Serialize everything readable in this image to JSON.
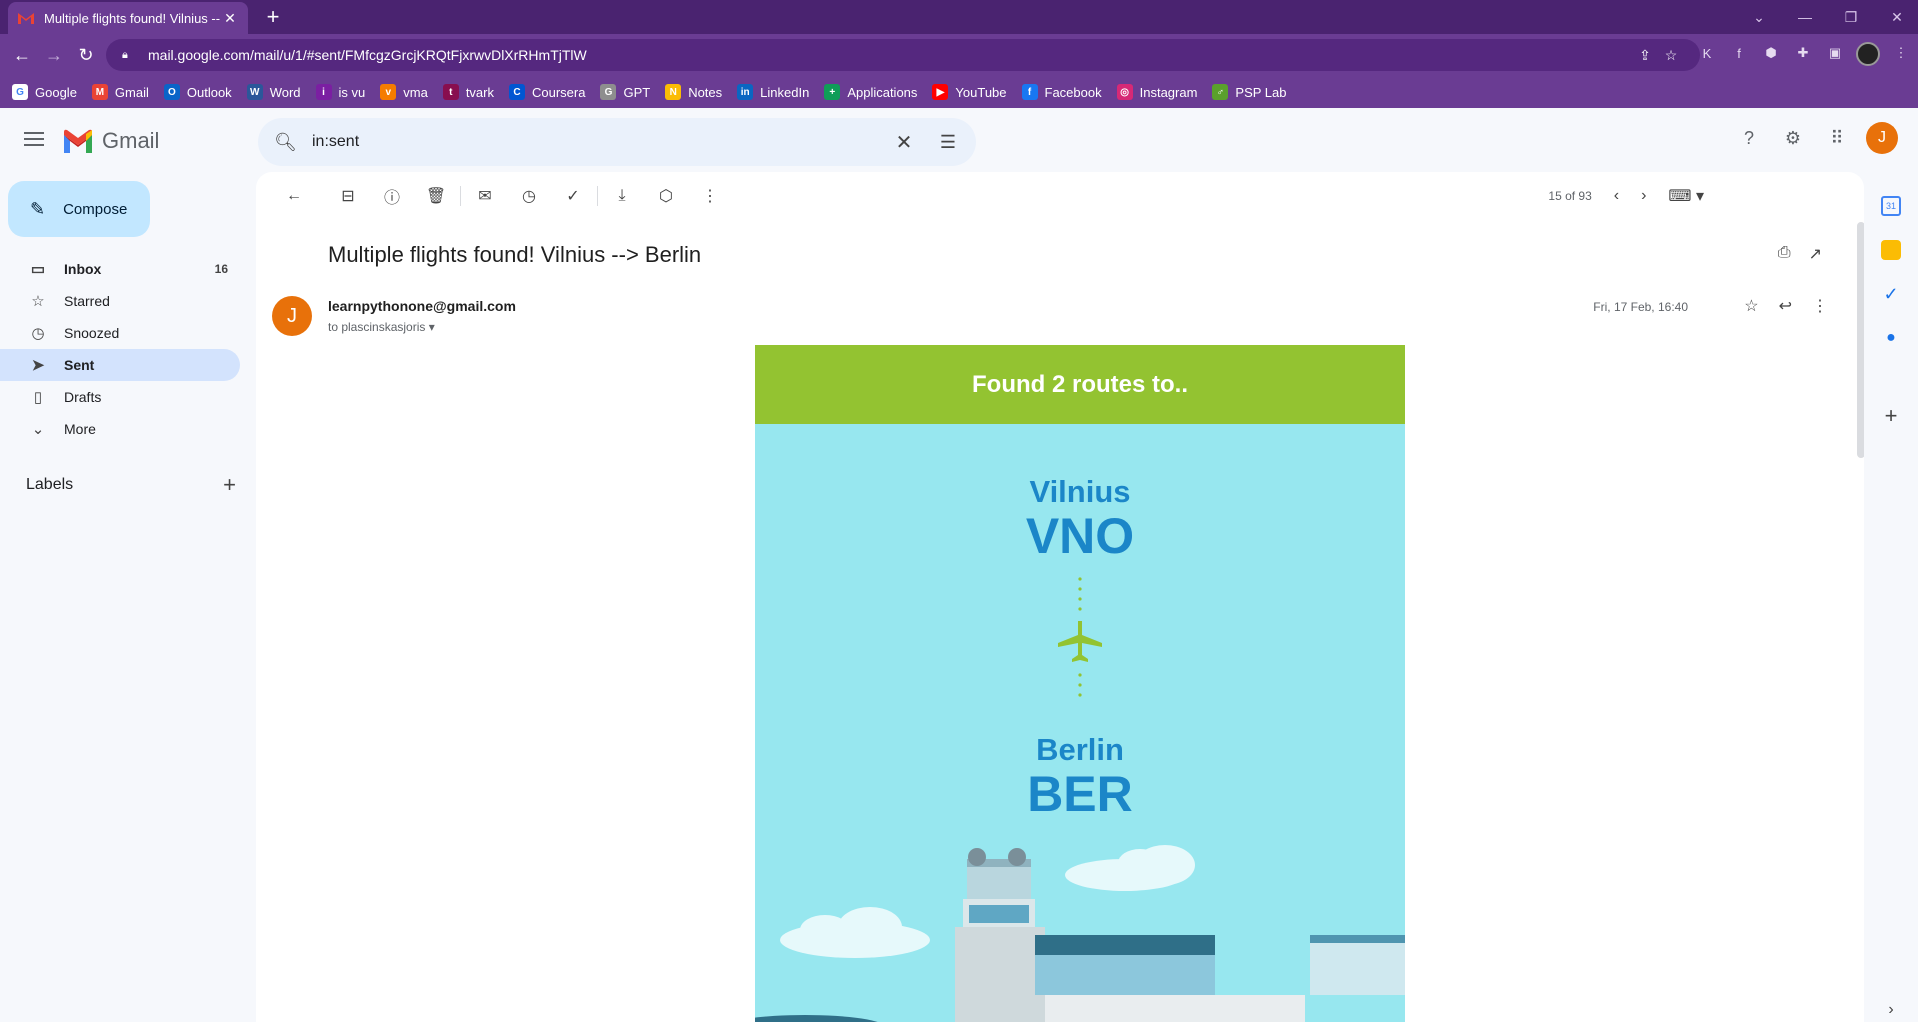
{
  "browser": {
    "tab_title": "Multiple flights found! Vilnius --",
    "url": "mail.google.com/mail/u/1/#sent/FMfcgzGrcjKRQtFjxrwvDlXrRHmTjTlW",
    "bookmarks": [
      {
        "label": "Google",
        "color": "#ffffff",
        "glyph": "G"
      },
      {
        "label": "Gmail",
        "color": "#ea4335",
        "glyph": "M"
      },
      {
        "label": "Outlook",
        "color": "#0a64c8",
        "glyph": "O"
      },
      {
        "label": "Word",
        "color": "#2b579a",
        "glyph": "W"
      },
      {
        "label": "is vu",
        "color": "#7b1fa2",
        "glyph": "i"
      },
      {
        "label": "vma",
        "color": "#f57c00",
        "glyph": "v"
      },
      {
        "label": "tvark",
        "color": "#880e4f",
        "glyph": "t"
      },
      {
        "label": "Coursera",
        "color": "#0056d2",
        "glyph": "C"
      },
      {
        "label": "GPT",
        "color": "#8e8e8e",
        "glyph": "G"
      },
      {
        "label": "Notes",
        "color": "#fbbc04",
        "glyph": "N"
      },
      {
        "label": "LinkedIn",
        "color": "#0a66c2",
        "glyph": "in"
      },
      {
        "label": "Applications",
        "color": "#0f9d58",
        "glyph": "+"
      },
      {
        "label": "YouTube",
        "color": "#ff0000",
        "glyph": "▶"
      },
      {
        "label": "Facebook",
        "color": "#1877f2",
        "glyph": "f"
      },
      {
        "label": "Instagram",
        "color": "#d62976",
        "glyph": "◎"
      },
      {
        "label": "PSP Lab",
        "color": "#5aa02c",
        "glyph": "♂"
      }
    ]
  },
  "gmail": {
    "brand": "Gmail",
    "search_query": "in:sent",
    "compose_label": "Compose",
    "avatar_letter": "J",
    "nav": [
      {
        "label": "Inbox",
        "count": "16",
        "icon": "inbox-icon",
        "glyph": "▭"
      },
      {
        "label": "Starred",
        "count": "",
        "icon": "star-icon",
        "glyph": "☆"
      },
      {
        "label": "Snoozed",
        "count": "",
        "icon": "clock-icon",
        "glyph": "◷"
      },
      {
        "label": "Sent",
        "count": "",
        "icon": "send-icon",
        "glyph": "➤"
      },
      {
        "label": "Drafts",
        "count": "",
        "icon": "draft-icon",
        "glyph": "▯"
      },
      {
        "label": "More",
        "count": "",
        "icon": "chevron-down-icon",
        "glyph": "⌄"
      }
    ],
    "labels_title": "Labels"
  },
  "message": {
    "pager": "15 of 93",
    "subject": "Multiple flights found! Vilnius --> Berlin",
    "sender": "learnpythonone@gmail.com",
    "avatar_letter": "J",
    "to": "to plascinskasjoris",
    "date": "Fri, 17 Feb, 16:40",
    "email_body": {
      "banner": "Found 2 routes to..",
      "origin_city": "Vilnius",
      "origin_code": "VNO",
      "destination_city": "Berlin",
      "destination_code": "BER"
    }
  }
}
